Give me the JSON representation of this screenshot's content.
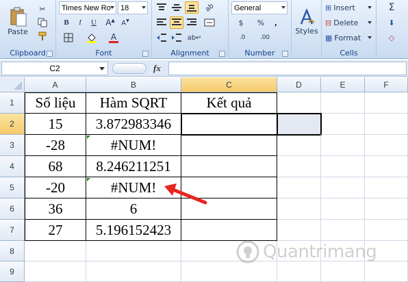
{
  "ribbon": {
    "clipboard": {
      "label": "Clipboard",
      "paste": "Paste"
    },
    "font": {
      "label": "Font",
      "family": "Times New Ro",
      "size": "18",
      "bold": "B",
      "italic": "I",
      "underline": "U",
      "font_color": "A",
      "highlight": "ab"
    },
    "alignment": {
      "label": "Alignment"
    },
    "number": {
      "label": "Number",
      "format": "General",
      "currency": "$",
      "percent": "%",
      "comma": ",",
      "inc_dec": ".0",
      "dec_dec": ".00"
    },
    "styles": {
      "label": "Styles"
    },
    "cells": {
      "label": "Cells",
      "insert": "Insert",
      "delete": "Delete",
      "format": "Format"
    },
    "editing": {
      "sum": "Σ"
    }
  },
  "formula_bar": {
    "name_box": "C2",
    "fx": "fx",
    "formula": ""
  },
  "columns": [
    "A",
    "B",
    "C",
    "D",
    "E",
    "F"
  ],
  "rows": [
    "1",
    "2",
    "3",
    "4",
    "5",
    "6",
    "7",
    "8",
    "9"
  ],
  "cells": {
    "A1": "Số liệu",
    "B1": "Hàm SQRT",
    "C1": "Kết quả",
    "A2": "15",
    "B2": "3.872983346",
    "A3": "-28",
    "B3": "#NUM!",
    "A4": "68",
    "B4": "8.246211251",
    "A5": "-20",
    "B5": "#NUM!",
    "A6": "36",
    "B6": "6",
    "A7": "27",
    "B7": "5.196152423"
  },
  "watermark": "Quantrimang",
  "colors": {
    "arrow": "#e8261f",
    "ribbon_text": "#15428b",
    "selection": "#000000"
  }
}
